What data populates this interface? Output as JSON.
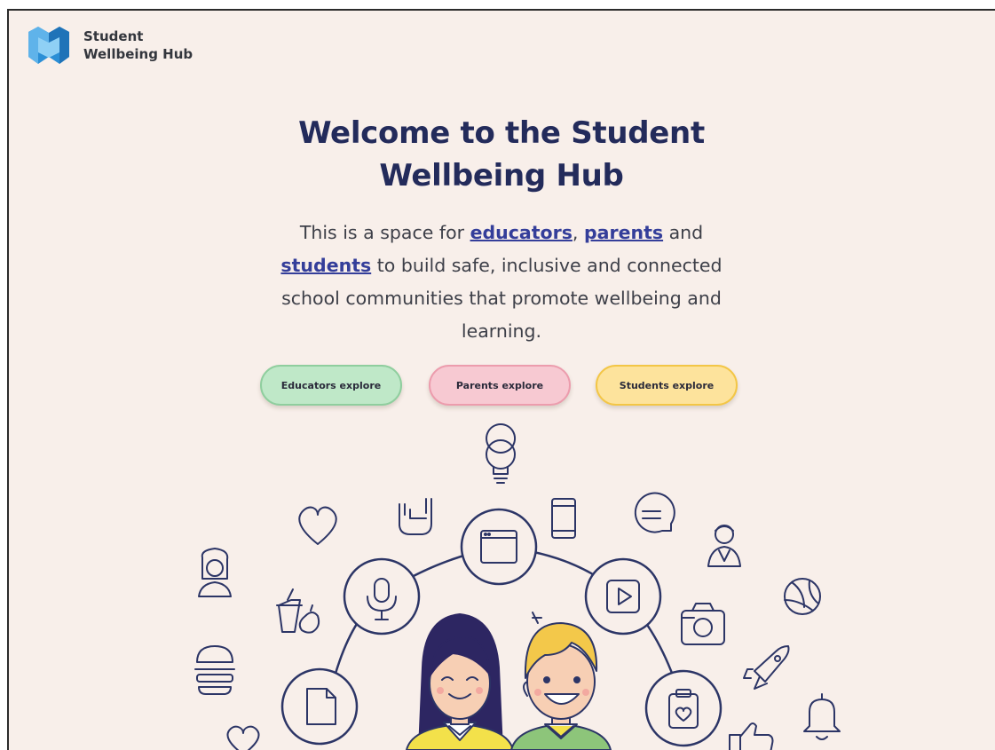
{
  "brand": {
    "name_line1": "Student",
    "name_line2": "Wellbeing Hub"
  },
  "hero": {
    "title_line1": "Welcome to the Student",
    "title_line2": "Wellbeing Hub",
    "intro_part1": "This is a space for ",
    "link_educators": "educators",
    "intro_sep": ", ",
    "link_parents": "parents",
    "intro_part2": " and ",
    "link_students": "students",
    "intro_part3": " to build safe, inclusive and connected school communities that promote wellbeing and learning."
  },
  "buttons": {
    "educators": "Educators explore",
    "parents": "Parents explore",
    "students": "Students explore"
  },
  "illustration": {
    "icons": [
      "lightbulb-icon",
      "heart-icon",
      "rock-hand-icon",
      "phone-icon",
      "chat-bubble-icon",
      "doctor-icon",
      "volleyball-icon",
      "female-user-icon",
      "drink-apple-icon",
      "camera-icon",
      "rocket-icon",
      "burger-icon",
      "bell-icon",
      "thumbs-up-icon",
      "heart-outline-icon",
      "browser-window-icon",
      "microphone-icon",
      "play-button-icon",
      "document-icon",
      "clipboard-heart-icon",
      "girl-avatar",
      "boy-avatar"
    ]
  },
  "colors": {
    "background": "#f8efea",
    "heading": "#232b5b",
    "link": "#343e9a",
    "educators": "#bfe8c8",
    "parents": "#f7c9d2",
    "students": "#fde39c",
    "line_art": "#2c3566",
    "logo_blue": "#2b8fd6"
  }
}
